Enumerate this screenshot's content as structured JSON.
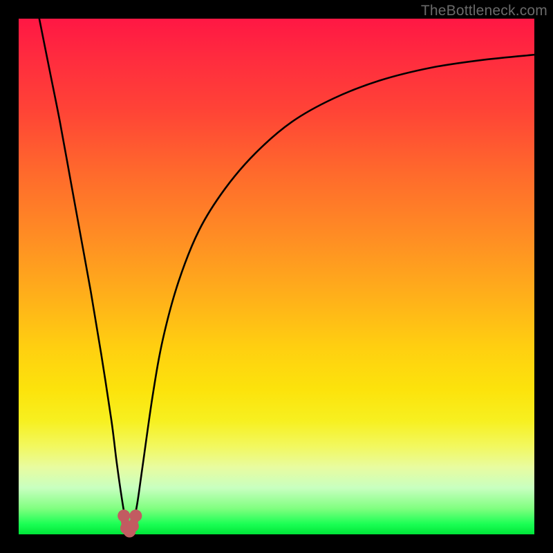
{
  "watermark": "TheBottleneck.com",
  "colors": {
    "frame": "#000000",
    "curve": "#000000",
    "marker": "#c25b61",
    "gradient_top": "#ff1744",
    "gradient_bottom": "#00e639"
  },
  "chart_data": {
    "type": "line",
    "title": "",
    "xlabel": "",
    "ylabel": "",
    "xlim": [
      0,
      100
    ],
    "ylim": [
      0,
      100
    ],
    "grid": false,
    "legend": false,
    "series": [
      {
        "name": "bottleneck-curve",
        "x": [
          4,
          6,
          8,
          10,
          12,
          14,
          16,
          18,
          19,
          20,
          20.8,
          21.5,
          22.2,
          23,
          24,
          26,
          28,
          31,
          35,
          40,
          46,
          53,
          61,
          70,
          80,
          90,
          100
        ],
        "y": [
          100,
          90,
          80,
          69,
          58,
          47,
          35,
          22,
          14,
          7,
          2.4,
          0.6,
          2.2,
          6,
          13,
          27,
          38,
          49,
          59,
          67,
          74,
          80,
          84.5,
          88,
          90.5,
          92,
          93
        ]
      }
    ],
    "markers": {
      "name": "bottleneck-markers",
      "x": [
        20.4,
        20.9,
        21.5,
        22.1,
        22.7
      ],
      "y": [
        3.6,
        1.2,
        0.6,
        1.6,
        3.6
      ]
    },
    "minimum_x": 21.5
  }
}
